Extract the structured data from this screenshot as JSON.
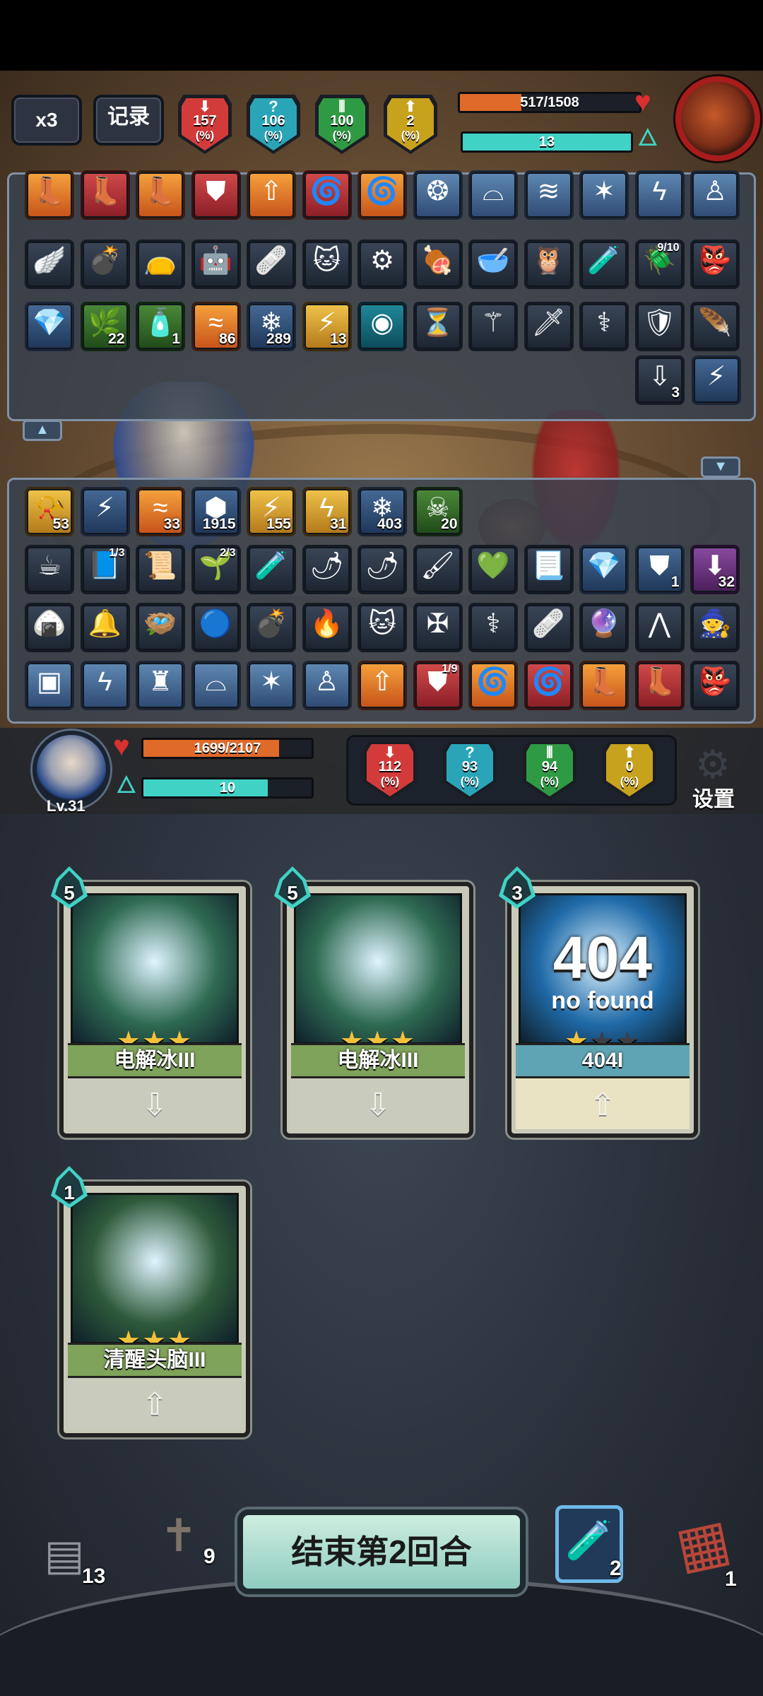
{
  "enemy": {
    "speed_label": "x3",
    "record_label": "记录",
    "stats": [
      {
        "glyph": "⬇",
        "value": "157",
        "unit": "(%)",
        "color": "#d33b3b"
      },
      {
        "glyph": "?",
        "value": "106",
        "unit": "(%)",
        "color": "#2aa5b8"
      },
      {
        "glyph": "⦀",
        "value": "100",
        "unit": "(%)",
        "color": "#2f9a44"
      },
      {
        "glyph": "⬆",
        "value": "2",
        "unit": "(%)",
        "color": "#c7a21c"
      }
    ],
    "hp_text": "517/1508",
    "hp_fraction": 0.343,
    "energy_text": "13",
    "energy_fraction": 1.0
  },
  "enemy_items": {
    "row1": [
      {
        "icon": "boot-icon",
        "glyph": "👢",
        "style": "orange"
      },
      {
        "icon": "boot-icon",
        "glyph": "👢",
        "style": "red"
      },
      {
        "icon": "boot-icon",
        "glyph": "👢",
        "style": "orange"
      },
      {
        "icon": "shield-icon",
        "glyph": "⛊",
        "style": "red"
      },
      {
        "icon": "arrow-up-icon",
        "glyph": "⇧",
        "style": "orange"
      },
      {
        "icon": "swirl-icon",
        "glyph": "🌀",
        "style": "red"
      },
      {
        "icon": "swirl-icon",
        "glyph": "🌀",
        "style": "orange"
      },
      {
        "icon": "rune-icon",
        "glyph": "❂",
        "style": "blue"
      },
      {
        "icon": "dome-icon",
        "glyph": "⌓",
        "style": "blue"
      },
      {
        "icon": "dragon-icon",
        "glyph": "≋",
        "style": "blue"
      },
      {
        "icon": "claw-icon",
        "glyph": "✶",
        "style": "blue"
      },
      {
        "icon": "crack-icon",
        "glyph": "ϟ",
        "style": "blue"
      },
      {
        "icon": "figure-icon",
        "glyph": "♙",
        "style": "blue"
      }
    ],
    "row2": [
      {
        "icon": "wings-icon",
        "glyph": "🪽",
        "style": "gray"
      },
      {
        "icon": "bomb-icon",
        "glyph": "💣",
        "style": "gray"
      },
      {
        "icon": "sack-icon",
        "glyph": "👝",
        "style": "gray"
      },
      {
        "icon": "robot-icon",
        "glyph": "🤖",
        "style": "gray"
      },
      {
        "icon": "bandage-icon",
        "glyph": "🩹",
        "style": "gray"
      },
      {
        "icon": "cat-icon",
        "glyph": "🐱",
        "style": "gray"
      },
      {
        "icon": "gear-box-icon",
        "glyph": "⚙",
        "style": "gray"
      },
      {
        "icon": "meat-icon",
        "glyph": "🍖",
        "style": "gray"
      },
      {
        "icon": "bowl-icon",
        "glyph": "🥣",
        "style": "gray"
      },
      {
        "icon": "owl-icon",
        "glyph": "🦉",
        "style": "gray"
      },
      {
        "icon": "potion-icon",
        "glyph": "🧪",
        "style": "gray"
      },
      {
        "icon": "beetle-icon",
        "glyph": "🪲",
        "style": "gray",
        "frac": "9/10"
      },
      {
        "icon": "goblin-icon",
        "glyph": "👺",
        "style": "gray"
      }
    ],
    "row3": [
      {
        "icon": "crystal-icon",
        "glyph": "💎",
        "style": "frost"
      },
      {
        "icon": "vine-icon",
        "glyph": "🌿",
        "style": "green",
        "count": "22"
      },
      {
        "icon": "slime-icon",
        "glyph": "🧴",
        "style": "green",
        "count": "1"
      },
      {
        "icon": "wave-icon",
        "glyph": "≈",
        "style": "orange",
        "count": "86"
      },
      {
        "icon": "snowflake-icon",
        "glyph": "❄",
        "style": "frost",
        "count": "289"
      },
      {
        "icon": "lightning-icon",
        "glyph": "⚡",
        "style": "gold",
        "count": "13"
      },
      {
        "icon": "orb-icon",
        "glyph": "◉",
        "style": "teal"
      },
      {
        "icon": "hourglass-icon",
        "glyph": "⏳",
        "style": "gray"
      },
      {
        "icon": "staff-icon",
        "glyph": "⚚",
        "style": "gray"
      },
      {
        "icon": "dagger-icon",
        "glyph": "🗡",
        "style": "gray"
      },
      {
        "icon": "scepter-icon",
        "glyph": "⚕",
        "style": "gray"
      },
      {
        "icon": "shield-round-icon",
        "glyph": "🛡",
        "style": "gray"
      },
      {
        "icon": "feather-icon",
        "glyph": "🪶",
        "style": "gray"
      }
    ],
    "row4": [
      {
        "icon": "arrow-down-icon",
        "glyph": "⇩",
        "style": "gray",
        "count": "3"
      },
      {
        "icon": "lightning-vortex-icon",
        "glyph": "⚡",
        "style": "frost"
      }
    ]
  },
  "hero_items": {
    "row1": [
      {
        "icon": "horn-icon",
        "glyph": "📯",
        "style": "gold",
        "count": "53"
      },
      {
        "icon": "lightning-vortex-icon",
        "glyph": "⚡",
        "style": "frost"
      },
      {
        "icon": "wave-icon",
        "glyph": "≈",
        "style": "orange",
        "count": "33"
      },
      {
        "icon": "armor-icon",
        "glyph": "⬢",
        "style": "frost",
        "count": "1915"
      },
      {
        "icon": "lightning-icon",
        "glyph": "⚡",
        "style": "gold",
        "count": "155"
      },
      {
        "icon": "thunder-icon",
        "glyph": "ϟ",
        "style": "gold",
        "count": "31"
      },
      {
        "icon": "snowflake-icon",
        "glyph": "❄",
        "style": "frost",
        "count": "403"
      },
      {
        "icon": "skull-icon",
        "glyph": "☠",
        "style": "green",
        "count": "20"
      }
    ],
    "row2": [
      {
        "icon": "teacup-icon",
        "glyph": "☕",
        "style": "gray"
      },
      {
        "icon": "book-icon",
        "glyph": "📘",
        "style": "gray",
        "frac": "1/3"
      },
      {
        "icon": "scroll-icon",
        "glyph": "📜",
        "style": "gray"
      },
      {
        "icon": "plant-icon",
        "glyph": "🌱",
        "style": "gray",
        "frac": "2/3"
      },
      {
        "icon": "potion-icon",
        "glyph": "🧪",
        "style": "gray"
      },
      {
        "icon": "chili-icon",
        "glyph": "🌶",
        "style": "gray"
      },
      {
        "icon": "chili-icon",
        "glyph": "🌶",
        "style": "gray"
      },
      {
        "icon": "brush-icon",
        "glyph": "🖌",
        "style": "gray"
      },
      {
        "icon": "gem-icon",
        "glyph": "💚",
        "style": "gray"
      },
      {
        "icon": "scroll-paper-icon",
        "glyph": "📃",
        "style": "gray"
      },
      {
        "icon": "crystal-icon",
        "glyph": "💎",
        "style": "frost"
      },
      {
        "icon": "shield-icon",
        "glyph": "⛊",
        "style": "frost",
        "count": "1"
      },
      {
        "icon": "down-arrow-figure-icon",
        "glyph": "⬇",
        "style": "purple",
        "count": "32"
      }
    ],
    "row3": [
      {
        "icon": "rice-ball-icon",
        "glyph": "🍙",
        "style": "gray"
      },
      {
        "icon": "bell-icon",
        "glyph": "🔔",
        "style": "gray"
      },
      {
        "icon": "nest-icon",
        "glyph": "🪺",
        "style": "gray"
      },
      {
        "icon": "blue-orb-icon",
        "glyph": "🔵",
        "style": "gray"
      },
      {
        "icon": "bomb-icon",
        "glyph": "💣",
        "style": "gray"
      },
      {
        "icon": "fire-cup-icon",
        "glyph": "🔥",
        "style": "gray"
      },
      {
        "icon": "cat-icon",
        "glyph": "🐱",
        "style": "gray"
      },
      {
        "icon": "crossbow-icon",
        "glyph": "✠",
        "style": "gray"
      },
      {
        "icon": "scepter-icon",
        "glyph": "⚕",
        "style": "gray"
      },
      {
        "icon": "bandage-icon",
        "glyph": "🩹",
        "style": "gray"
      },
      {
        "icon": "crystals-icon",
        "glyph": "🔮",
        "style": "gray"
      },
      {
        "icon": "trap-icon",
        "glyph": "⋀",
        "style": "gray"
      },
      {
        "icon": "witch-icon",
        "glyph": "🧙",
        "style": "gray"
      }
    ],
    "row4": [
      {
        "icon": "save-icon",
        "glyph": "▣",
        "style": "blue"
      },
      {
        "icon": "crack-icon",
        "glyph": "ϟ",
        "style": "blue"
      },
      {
        "icon": "totem-icon",
        "glyph": "♜",
        "style": "blue"
      },
      {
        "icon": "dome-icon",
        "glyph": "⌓",
        "style": "blue"
      },
      {
        "icon": "claw-icon",
        "glyph": "✶",
        "style": "blue"
      },
      {
        "icon": "figure-icon",
        "glyph": "♙",
        "style": "blue"
      },
      {
        "icon": "arrow-up-icon",
        "glyph": "⇧",
        "style": "orange"
      },
      {
        "icon": "shield-icon",
        "glyph": "⛊",
        "style": "red",
        "frac": "1/9"
      },
      {
        "icon": "swirl-icon",
        "glyph": "🌀",
        "style": "orange"
      },
      {
        "icon": "swirl-icon",
        "glyph": "🌀",
        "style": "red"
      },
      {
        "icon": "boot-icon",
        "glyph": "👢",
        "style": "orange"
      },
      {
        "icon": "boot-icon",
        "glyph": "👢",
        "style": "red"
      },
      {
        "icon": "goblin-icon",
        "glyph": "👺",
        "style": "gray"
      }
    ]
  },
  "hero": {
    "level": "Lv.31",
    "hp_text": "1699/2107",
    "hp_fraction": 0.806,
    "energy_text": "10",
    "energy_fraction": 0.74,
    "stats": [
      {
        "glyph": "⬇",
        "value": "112",
        "unit": "(%)",
        "color": "#d33b3b"
      },
      {
        "glyph": "?",
        "value": "93",
        "unit": "(%)",
        "color": "#2aa5b8"
      },
      {
        "glyph": "⦀",
        "value": "94",
        "unit": "(%)",
        "color": "#2f9a44"
      },
      {
        "glyph": "⬆",
        "value": "0",
        "unit": "(%)",
        "color": "#c7a21c"
      }
    ],
    "settings_label": "设置"
  },
  "hand": [
    {
      "cost": "5",
      "name": "电解冰III",
      "stars": 3,
      "art": "ice-cube-lightning-icon",
      "band_color": "#7fa35a",
      "art_color": "#2f6a52"
    },
    {
      "cost": "5",
      "name": "电解冰III",
      "stars": 3,
      "art": "ice-cube-lightning-icon",
      "band_color": "#7fa35a",
      "art_color": "#2f6a52"
    },
    {
      "cost": "3",
      "name": "404I",
      "stars": 1,
      "art_big": "404",
      "art_sub": "no found",
      "art": "404-burst-icon",
      "band_color": "#5fa4b4",
      "art_color": "#1f6aa8"
    },
    {
      "cost": "1",
      "name": "清醒头脑III",
      "stars": 3,
      "art": "rock-head-icon",
      "band_color": "#7fa35a",
      "art_color": "#2e5a3a"
    }
  ],
  "bottom": {
    "draw_pile_count": "13",
    "discard_pile_count": "9",
    "end_turn_label": "结束第2回合",
    "potion_count": "2",
    "exhaust_pile_count": "1"
  },
  "colors": {
    "hp": "#e06a2a",
    "energy": "#41d2c6",
    "panel_border": "#7f91a6",
    "end_turn_bg": "#b5e3d6"
  }
}
